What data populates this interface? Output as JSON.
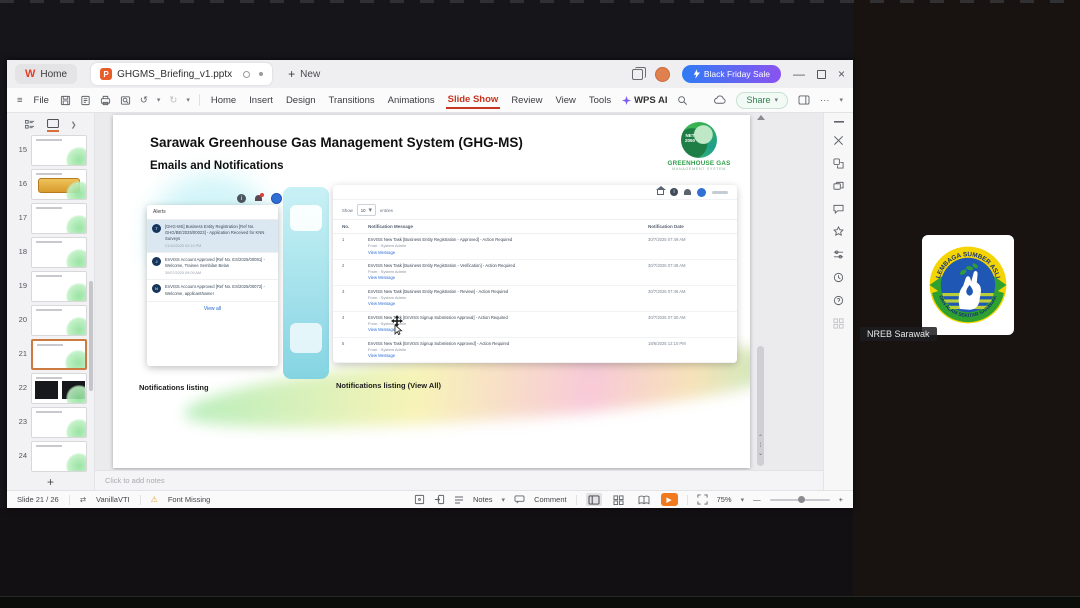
{
  "meeting": {
    "participant_name": "NREB Sarawak",
    "logo_top_text": "LEMBAGA SUMBER ASLI",
    "logo_bottom_text": "DAN ALAM SEKITAR SARAWAK"
  },
  "titlebar": {
    "home_tab": "Home",
    "document_tab": "GHGMS_Briefing_v1.pptx",
    "new_plus": "+",
    "new_label": "New",
    "promo_label": "Black Friday Sale",
    "minimize_glyph": "—",
    "close_glyph": "×"
  },
  "menubar": {
    "hamburger": "≡",
    "file": "File",
    "undo_glyph": "↺",
    "redo_glyph": "↻",
    "caret": "▾",
    "items": [
      "Home",
      "Insert",
      "Design",
      "Transitions",
      "Animations",
      "Slide Show",
      "Review",
      "View",
      "Tools"
    ],
    "wps_ai": "WPS AI",
    "share": "Share",
    "more": "···"
  },
  "thumbnail_panel": {
    "numbers": [
      15,
      16,
      17,
      18,
      19,
      20,
      21,
      22,
      23,
      24
    ],
    "add_label": "+"
  },
  "slide": {
    "title": "Sarawak Greenhouse Gas Management System (GHG-MS)",
    "subtitle": "Emails and Notifications",
    "brand": {
      "net_line1": "NET",
      "net_line2": "2050",
      "name": "GREENHOUSE GAS",
      "tagline": "MANAGEMENT SYSTEM"
    },
    "captions": {
      "left": "Notifications listing",
      "right": "Notifications listing (View All)"
    },
    "alerts": {
      "header": "Alerts",
      "view_all": "View all",
      "items": [
        {
          "initial": "T",
          "text": "[GHG-MS] Business Entity Registration [Ref No. GHG/BE/2025/00023] - Application Received for KNN Surveys",
          "time": "21/10/2025 02:19 PM"
        },
        {
          "initial": "J",
          "text": "EnVISS Account Approved [Ref No. ES/2025/00081] - Welcome, Trainee Sembilan Belas",
          "time": "30/07/2025 09:09 AM"
        },
        {
          "initial": "N",
          "text": "EnVISS Account Approved [Ref No. ES/2025/00072] - Welcome, applicantName!",
          "time": ""
        }
      ]
    },
    "notifications": {
      "show_label": "Show",
      "page_size": "10",
      "select_caret": "▾",
      "entries_label": "entries",
      "col_no": "No.",
      "col_message": "Notification Message",
      "col_date": "Notification Date",
      "rows": [
        {
          "no": "1",
          "message": "EnVISS New Task [Business Entity Registration - Approved] - Action Required",
          "from": "From : System Admin",
          "link": "View Message",
          "date": "30/7/2025 07:49 AM"
        },
        {
          "no": "2",
          "message": "EnVISS New Task [Business Entity Registration - Verification] - Action Required",
          "from": "From : System Admin",
          "link": "View Message",
          "date": "30/7/2025 07:48 AM"
        },
        {
          "no": "3",
          "message": "EnVISS New Task [Business Entity Registration - Review] - Action Required",
          "from": "From : System Admin",
          "link": "View Message",
          "date": "30/7/2025 07:46 AM"
        },
        {
          "no": "4",
          "message": "EnVISS New Task [EnVISS Signup Submission Approval] - Action Required",
          "from": "From : System Admin",
          "link": "View Message",
          "date": "30/7/2025 07:30 AM"
        },
        {
          "no": "5",
          "message": "EnVISS New Task [EnVISS Signup Submission Approved] - Action Required",
          "from": "From : System Admin",
          "link": "View Message",
          "date": "18/6/2025 12:10 PM"
        }
      ]
    }
  },
  "notes_bar": {
    "placeholder": "Click to add notes"
  },
  "statusbar": {
    "slide_indicator": "Slide 21 / 26",
    "proofing_glyph": "⇄",
    "theme_name": "VanillaVTI",
    "warning_glyph": "⚠",
    "font_missing": "Font Missing",
    "notes_label": "Notes",
    "notes_caret": "▾",
    "comment_label": "Comment",
    "play_glyph": "▶",
    "zoom_level": "75%",
    "zoom_caret": "▾",
    "zoom_out": "—",
    "zoom_in": "+"
  }
}
